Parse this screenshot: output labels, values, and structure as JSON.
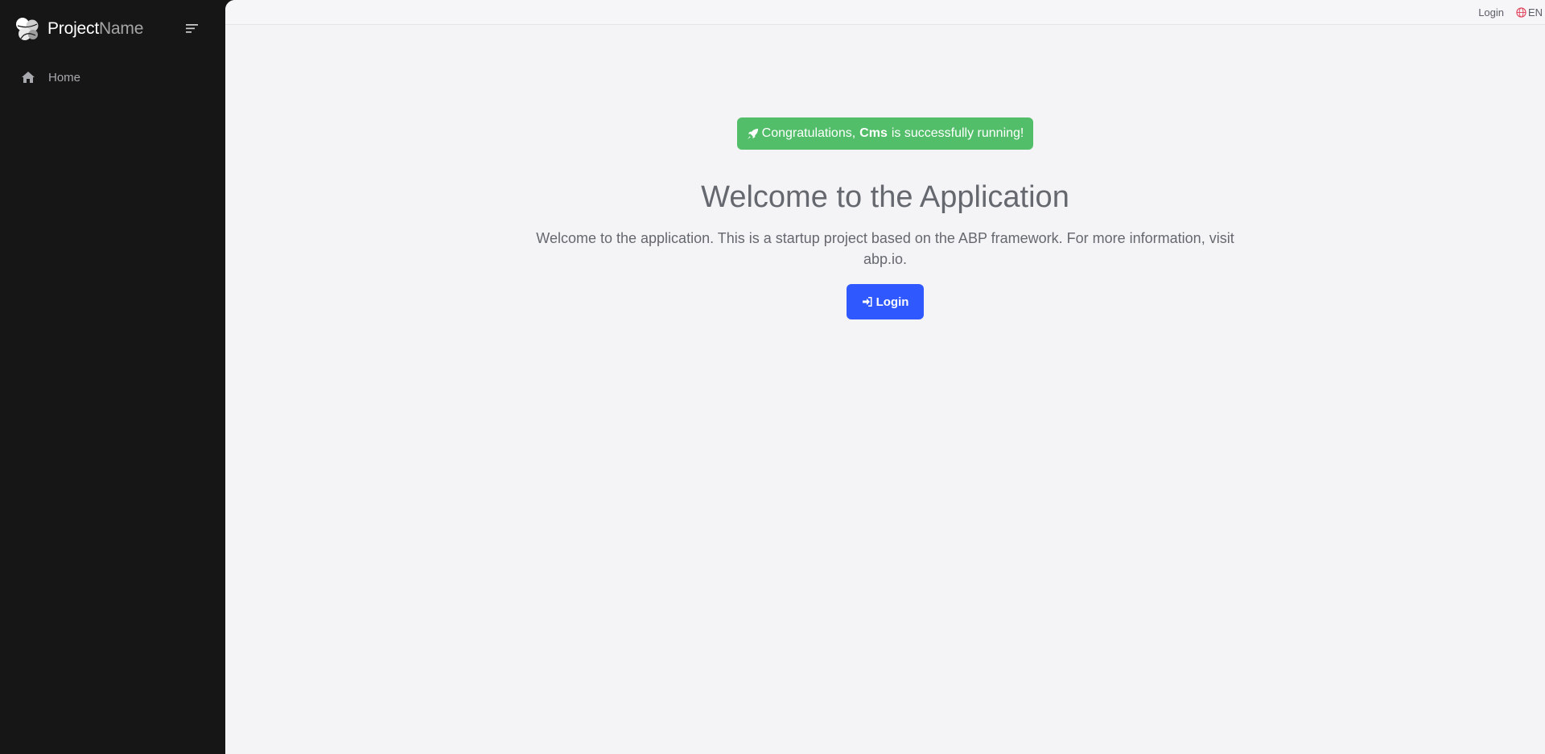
{
  "sidebar": {
    "brand": {
      "project": "Project",
      "name": "Name",
      "logo_icon": "abp-logo-icon"
    },
    "menu_toggle_icon": "menu-lines-icon",
    "items": [
      {
        "label": "Home",
        "icon": "home-icon"
      }
    ]
  },
  "topbar": {
    "login_label": "Login",
    "language": "EN",
    "language_icon": "globe-icon"
  },
  "hero": {
    "alert": {
      "prefix": "Congratulations,",
      "app": "Cms",
      "suffix": "is successfully running!",
      "icon": "rocket-icon",
      "color": "#52be69"
    },
    "title": "Welcome to the Application",
    "description": "Welcome to the application. This is a startup project based on the ABP framework. For more information, visit abp.io.",
    "login_button": {
      "label": "Login",
      "icon": "sign-in-icon",
      "color": "#2f58ff"
    }
  },
  "colors": {
    "sidebar_bg": "#161616",
    "main_bg": "#f4f4f6",
    "text_muted": "#65686e"
  }
}
